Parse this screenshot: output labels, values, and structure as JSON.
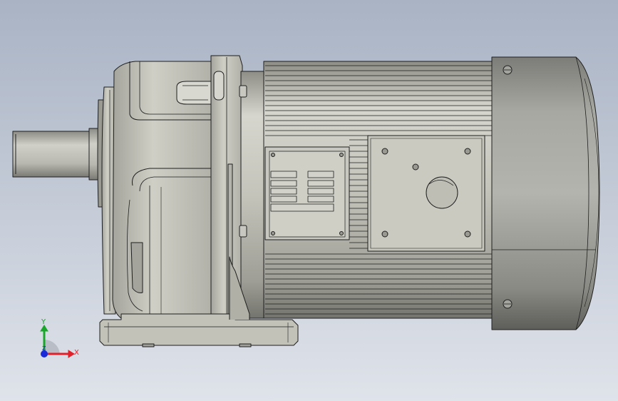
{
  "viewport": {
    "background_top": "#a9b3c4",
    "background_bottom": "#dfe3ea"
  },
  "model": {
    "body_color": "#bcbcb2",
    "shadow_color": "#8a8a82",
    "highlight_color": "#e6e6de",
    "edge_color": "#1e1e1e",
    "housing_color": "#a6a6a0"
  },
  "triad": {
    "x_label": "X",
    "y_label": "Y",
    "z_label": "Z",
    "x_color": "#e0202a",
    "y_color": "#1aa62a",
    "z_color": "#1a2ad8"
  }
}
